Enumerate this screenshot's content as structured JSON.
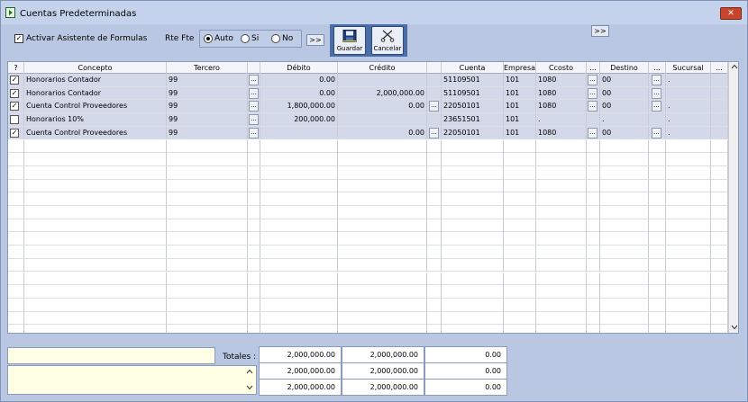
{
  "window": {
    "title": "Cuentas Predeterminadas",
    "close_label": "✕"
  },
  "toolbar": {
    "asistente_label": "Activar Asistente de Formulas",
    "asistente_checked": "✓",
    "rte_label": "Rte Fte",
    "rte_options": [
      "Auto",
      "Si",
      "No"
    ],
    "more_label": ">>",
    "expand_label": ">>",
    "save_label": "Guardar",
    "cancel_label": "Cancelar"
  },
  "grid": {
    "headers": [
      "?",
      "Concepto",
      "Tercero",
      "",
      "Débito",
      "Crédito",
      "",
      "Cuenta",
      "Empresa",
      "Ccosto",
      "...",
      "Destino",
      "...",
      "Sucursal",
      "..."
    ],
    "rows": [
      {
        "check": "✓",
        "concepto": "Honorarios Contador",
        "tercero": "99",
        "debito": "0.00",
        "credito": "",
        "cuenta": "51109501",
        "empresa": "101",
        "ccosto": "1080",
        "destino": "00",
        "sucursal": "."
      },
      {
        "check": "✓",
        "concepto": "Honorarios Contador",
        "tercero": "99",
        "debito": "0.00",
        "credito": "2,000,000.00",
        "cuenta": "51109501",
        "empresa": "101",
        "ccosto": "1080",
        "destino": "00",
        "sucursal": ""
      },
      {
        "check": "✓",
        "concepto": "Cuenta Control Proveedores",
        "tercero": "99",
        "debito": "1,800,000.00",
        "credito": "0.00",
        "cuenta": "22050101",
        "empresa": "101",
        "ccosto": "1080",
        "destino": "00",
        "sucursal": "."
      },
      {
        "check": "",
        "concepto": "Honorarios 10%",
        "tercero": "99",
        "debito": "200,000.00",
        "credito": "",
        "cuenta": "23651501",
        "empresa": "101",
        "ccosto": ".",
        "destino": ".",
        "sucursal": "."
      },
      {
        "check": "✓",
        "concepto": "Cuenta Control Proveedores",
        "tercero": "99",
        "debito": "",
        "credito": "0.00",
        "cuenta": "22050101",
        "empresa": "101",
        "ccosto": "1080",
        "destino": "00",
        "sucursal": "."
      }
    ],
    "dots_label": "..."
  },
  "totals": {
    "label": "Totales :",
    "lines": [
      [
        "2,000,000.00",
        "2,000,000.00",
        "0.00"
      ],
      [
        "2,000,000.00",
        "2,000,000.00",
        "0.00"
      ],
      [
        "2,000,000.00",
        "2,000,000.00",
        "0.00"
      ]
    ]
  }
}
